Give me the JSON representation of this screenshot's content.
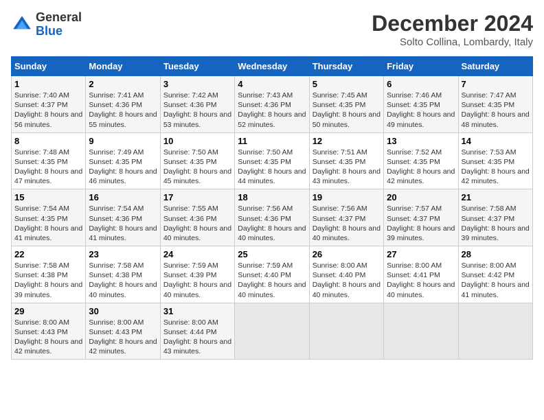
{
  "logo": {
    "line1": "General",
    "line2": "Blue"
  },
  "title": "December 2024",
  "location": "Solto Collina, Lombardy, Italy",
  "days_of_week": [
    "Sunday",
    "Monday",
    "Tuesday",
    "Wednesday",
    "Thursday",
    "Friday",
    "Saturday"
  ],
  "weeks": [
    [
      {
        "day": "1",
        "sunrise": "Sunrise: 7:40 AM",
        "sunset": "Sunset: 4:37 PM",
        "daylight": "Daylight: 8 hours and 56 minutes."
      },
      {
        "day": "2",
        "sunrise": "Sunrise: 7:41 AM",
        "sunset": "Sunset: 4:36 PM",
        "daylight": "Daylight: 8 hours and 55 minutes."
      },
      {
        "day": "3",
        "sunrise": "Sunrise: 7:42 AM",
        "sunset": "Sunset: 4:36 PM",
        "daylight": "Daylight: 8 hours and 53 minutes."
      },
      {
        "day": "4",
        "sunrise": "Sunrise: 7:43 AM",
        "sunset": "Sunset: 4:36 PM",
        "daylight": "Daylight: 8 hours and 52 minutes."
      },
      {
        "day": "5",
        "sunrise": "Sunrise: 7:45 AM",
        "sunset": "Sunset: 4:35 PM",
        "daylight": "Daylight: 8 hours and 50 minutes."
      },
      {
        "day": "6",
        "sunrise": "Sunrise: 7:46 AM",
        "sunset": "Sunset: 4:35 PM",
        "daylight": "Daylight: 8 hours and 49 minutes."
      },
      {
        "day": "7",
        "sunrise": "Sunrise: 7:47 AM",
        "sunset": "Sunset: 4:35 PM",
        "daylight": "Daylight: 8 hours and 48 minutes."
      }
    ],
    [
      {
        "day": "8",
        "sunrise": "Sunrise: 7:48 AM",
        "sunset": "Sunset: 4:35 PM",
        "daylight": "Daylight: 8 hours and 47 minutes."
      },
      {
        "day": "9",
        "sunrise": "Sunrise: 7:49 AM",
        "sunset": "Sunset: 4:35 PM",
        "daylight": "Daylight: 8 hours and 46 minutes."
      },
      {
        "day": "10",
        "sunrise": "Sunrise: 7:50 AM",
        "sunset": "Sunset: 4:35 PM",
        "daylight": "Daylight: 8 hours and 45 minutes."
      },
      {
        "day": "11",
        "sunrise": "Sunrise: 7:50 AM",
        "sunset": "Sunset: 4:35 PM",
        "daylight": "Daylight: 8 hours and 44 minutes."
      },
      {
        "day": "12",
        "sunrise": "Sunrise: 7:51 AM",
        "sunset": "Sunset: 4:35 PM",
        "daylight": "Daylight: 8 hours and 43 minutes."
      },
      {
        "day": "13",
        "sunrise": "Sunrise: 7:52 AM",
        "sunset": "Sunset: 4:35 PM",
        "daylight": "Daylight: 8 hours and 42 minutes."
      },
      {
        "day": "14",
        "sunrise": "Sunrise: 7:53 AM",
        "sunset": "Sunset: 4:35 PM",
        "daylight": "Daylight: 8 hours and 42 minutes."
      }
    ],
    [
      {
        "day": "15",
        "sunrise": "Sunrise: 7:54 AM",
        "sunset": "Sunset: 4:35 PM",
        "daylight": "Daylight: 8 hours and 41 minutes."
      },
      {
        "day": "16",
        "sunrise": "Sunrise: 7:54 AM",
        "sunset": "Sunset: 4:36 PM",
        "daylight": "Daylight: 8 hours and 41 minutes."
      },
      {
        "day": "17",
        "sunrise": "Sunrise: 7:55 AM",
        "sunset": "Sunset: 4:36 PM",
        "daylight": "Daylight: 8 hours and 40 minutes."
      },
      {
        "day": "18",
        "sunrise": "Sunrise: 7:56 AM",
        "sunset": "Sunset: 4:36 PM",
        "daylight": "Daylight: 8 hours and 40 minutes."
      },
      {
        "day": "19",
        "sunrise": "Sunrise: 7:56 AM",
        "sunset": "Sunset: 4:37 PM",
        "daylight": "Daylight: 8 hours and 40 minutes."
      },
      {
        "day": "20",
        "sunrise": "Sunrise: 7:57 AM",
        "sunset": "Sunset: 4:37 PM",
        "daylight": "Daylight: 8 hours and 39 minutes."
      },
      {
        "day": "21",
        "sunrise": "Sunrise: 7:58 AM",
        "sunset": "Sunset: 4:37 PM",
        "daylight": "Daylight: 8 hours and 39 minutes."
      }
    ],
    [
      {
        "day": "22",
        "sunrise": "Sunrise: 7:58 AM",
        "sunset": "Sunset: 4:38 PM",
        "daylight": "Daylight: 8 hours and 39 minutes."
      },
      {
        "day": "23",
        "sunrise": "Sunrise: 7:58 AM",
        "sunset": "Sunset: 4:38 PM",
        "daylight": "Daylight: 8 hours and 40 minutes."
      },
      {
        "day": "24",
        "sunrise": "Sunrise: 7:59 AM",
        "sunset": "Sunset: 4:39 PM",
        "daylight": "Daylight: 8 hours and 40 minutes."
      },
      {
        "day": "25",
        "sunrise": "Sunrise: 7:59 AM",
        "sunset": "Sunset: 4:40 PM",
        "daylight": "Daylight: 8 hours and 40 minutes."
      },
      {
        "day": "26",
        "sunrise": "Sunrise: 8:00 AM",
        "sunset": "Sunset: 4:40 PM",
        "daylight": "Daylight: 8 hours and 40 minutes."
      },
      {
        "day": "27",
        "sunrise": "Sunrise: 8:00 AM",
        "sunset": "Sunset: 4:41 PM",
        "daylight": "Daylight: 8 hours and 40 minutes."
      },
      {
        "day": "28",
        "sunrise": "Sunrise: 8:00 AM",
        "sunset": "Sunset: 4:42 PM",
        "daylight": "Daylight: 8 hours and 41 minutes."
      }
    ],
    [
      {
        "day": "29",
        "sunrise": "Sunrise: 8:00 AM",
        "sunset": "Sunset: 4:43 PM",
        "daylight": "Daylight: 8 hours and 42 minutes."
      },
      {
        "day": "30",
        "sunrise": "Sunrise: 8:00 AM",
        "sunset": "Sunset: 4:43 PM",
        "daylight": "Daylight: 8 hours and 42 minutes."
      },
      {
        "day": "31",
        "sunrise": "Sunrise: 8:00 AM",
        "sunset": "Sunset: 4:44 PM",
        "daylight": "Daylight: 8 hours and 43 minutes."
      },
      null,
      null,
      null,
      null
    ]
  ]
}
